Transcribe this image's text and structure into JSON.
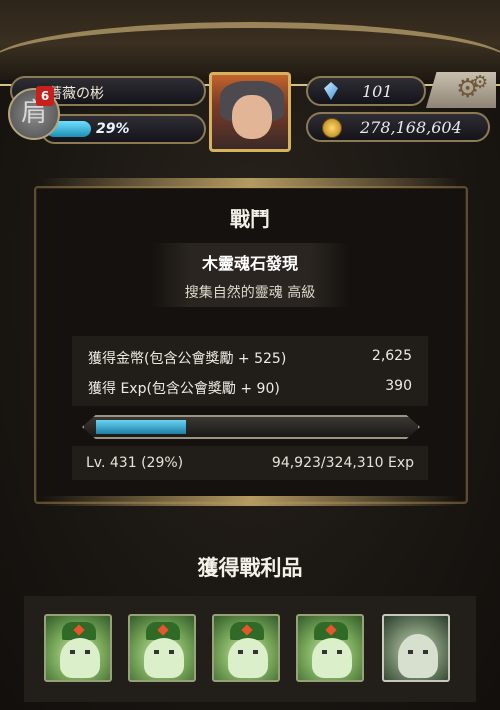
{
  "header": {
    "player_name": "薔薇の彬",
    "rank_glyph": "肩",
    "player_level_badge": "6",
    "exp_percent_label": "29%",
    "exp_fraction": 0.29,
    "gems": "101",
    "coins": "278,168,604"
  },
  "battle": {
    "title": "戰鬥",
    "quest_name": "木靈魂石發現",
    "quest_subtitle": "搜集自然的靈魂 高級",
    "rewards": [
      {
        "label": "獲得金幣(包含公會獎勵 + 525)",
        "value": "2,625"
      },
      {
        "label": "獲得 Exp(包含公會獎勵 + 90)",
        "value": "390"
      }
    ],
    "progress_fraction": 0.29,
    "level_text": "Lv. 431 (29%)",
    "exp_text": "94,923/324,310 Exp"
  },
  "loot": {
    "title": "獲得戰利品",
    "items": [
      {
        "icon": "wood-spirit-stone-icon"
      },
      {
        "icon": "wood-spirit-stone-icon"
      },
      {
        "icon": "wood-spirit-stone-icon"
      },
      {
        "icon": "wood-spirit-stone-icon"
      },
      {
        "icon": "wood-spirit-stone-advanced-icon"
      }
    ]
  }
}
